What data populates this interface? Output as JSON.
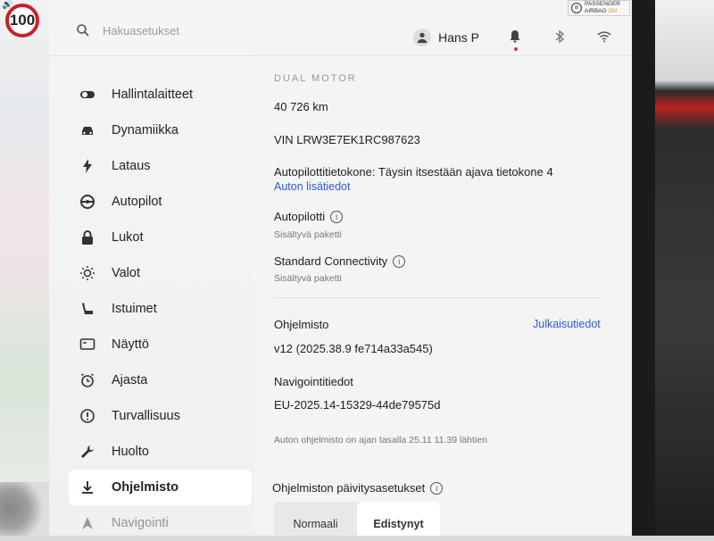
{
  "speed_limit": "100",
  "airbag": {
    "line1": "PASSENGER",
    "line2": "AIRBAG",
    "status": "ON"
  },
  "search": {
    "placeholder": "Hakuasetukset"
  },
  "user": {
    "name": "Hans P"
  },
  "sidebar": {
    "items": [
      {
        "label": "Hallintalaitteet",
        "icon": "toggle-icon"
      },
      {
        "label": "Dynamiikka",
        "icon": "car-icon"
      },
      {
        "label": "Lataus",
        "icon": "bolt-icon"
      },
      {
        "label": "Autopilot",
        "icon": "steering-wheel-icon"
      },
      {
        "label": "Lukot",
        "icon": "lock-icon"
      },
      {
        "label": "Valot",
        "icon": "sun-icon"
      },
      {
        "label": "Istuimet",
        "icon": "seat-icon"
      },
      {
        "label": "Näyttö",
        "icon": "display-icon"
      },
      {
        "label": "Ajasta",
        "icon": "alarm-clock-icon"
      },
      {
        "label": "Turvallisuus",
        "icon": "alert-circle-icon"
      },
      {
        "label": "Huolto",
        "icon": "wrench-icon"
      },
      {
        "label": "Ohjelmisto",
        "icon": "download-icon",
        "active": true
      },
      {
        "label": "Navigointi",
        "icon": "navigation-icon"
      }
    ]
  },
  "main": {
    "model_name": "DUAL MOTOR",
    "odometer": "40 726 km",
    "vin": "VIN LRW3E7EK1RC987623",
    "autopilot_computer": "Autopilottitietokone: Täysin itsestään ajava tietokone 4",
    "more_info_link": "Auton lisätiedot",
    "autopilot_title": "Autopilotti",
    "autopilot_sub": "Sisältyvä paketti",
    "connectivity_title": "Standard Connectivity",
    "connectivity_sub": "Sisältyvä paketti",
    "software_title": "Ohjelmisto",
    "release_notes_link": "Julkaisutiedot",
    "software_version": "v12 (2025.38.9 fe714a33a545)",
    "nav_data_title": "Navigointitiedot",
    "nav_data_version": "EU-2025.14-15329-44de79575d",
    "up_to_date": "Auton ohjelmisto on ajan tasalla 25.11 11.39 lähtien",
    "update_settings_title": "Ohjelmiston päivitysasetukset",
    "update_options": [
      "Normaali",
      "Edistynyt"
    ],
    "update_selected": "Edistynyt"
  },
  "colors": {
    "accent_link": "#2a5bd7",
    "speed_ring": "#c9202a",
    "notification_dot": "#dd3333"
  }
}
